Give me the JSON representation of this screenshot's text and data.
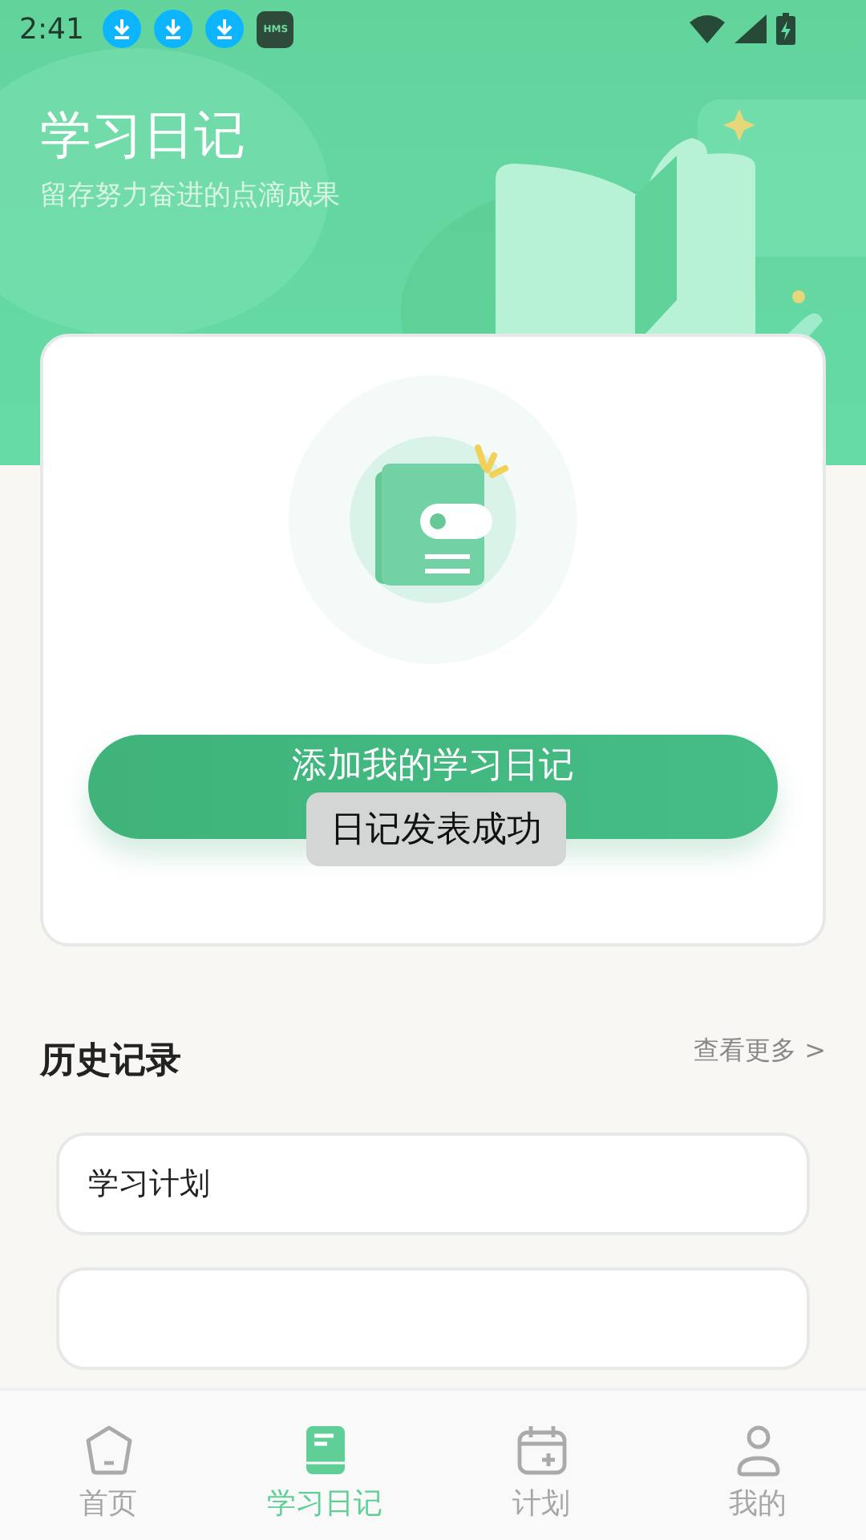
{
  "status_bar": {
    "time": "2:41",
    "notifications": [
      {
        "kind": "download"
      },
      {
        "kind": "download"
      },
      {
        "kind": "download"
      },
      {
        "kind": "hms",
        "label": "HMS"
      }
    ]
  },
  "header": {
    "title": "学习日记",
    "subtitle": "留存努力奋进的点滴成果"
  },
  "add_card": {
    "button": "添加我的学习日记"
  },
  "toast": "日记发表成功",
  "history": {
    "title": "历史记录",
    "more": "查看更多 >",
    "items": [
      {
        "kind": "text",
        "title": "学习计划"
      },
      {
        "kind": "blank"
      }
    ]
  },
  "tabs": [
    {
      "kind": "home",
      "label": "首页",
      "selected": false
    },
    {
      "kind": "diary",
      "label": "学习日记",
      "selected": true
    },
    {
      "kind": "plan",
      "label": "计划",
      "selected": false
    },
    {
      "kind": "profile",
      "label": "我的",
      "selected": false
    }
  ]
}
